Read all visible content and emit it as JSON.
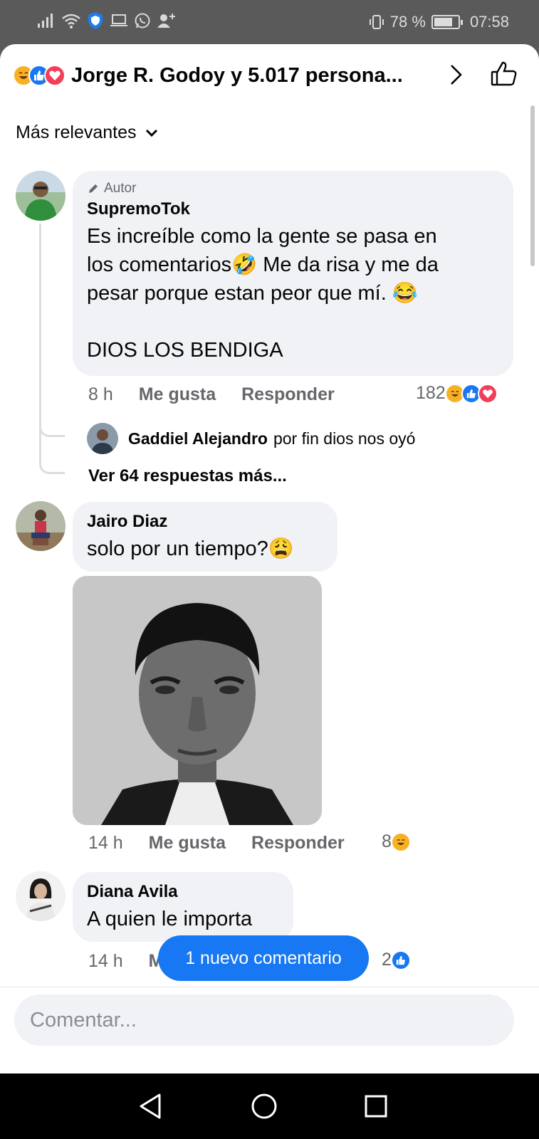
{
  "status_bar": {
    "battery_text": "78 %",
    "battery_level": 0.78,
    "time": "07:58"
  },
  "header": {
    "title": "Jorge R. Godoy y 5.017 persona...",
    "reaction_icons": [
      "haha-icon",
      "like-icon",
      "love-icon"
    ]
  },
  "sort": {
    "label": "Más relevantes"
  },
  "comments": [
    {
      "author_tag": "Autor",
      "name": "SupremoTok",
      "text_lines": [
        "Es increíble como la gente se pasa en",
        "los comentarios🤣 Me da risa y me da",
        "pesar porque estan peor que mí. 😂",
        "",
        "DIOS LOS BENDIGA"
      ],
      "time": "8 h",
      "like": "Me gusta",
      "reply": "Responder",
      "reaction_count": "182",
      "reply_preview": {
        "name": "Gaddiel Alejandro",
        "text": "por fin dios nos oyó"
      },
      "more_replies": "Ver 64 respuestas más..."
    },
    {
      "name": "Jairo Diaz",
      "text": "solo por un tiempo?😩",
      "time": "14 h",
      "like": "Me gusta",
      "reply": "Responder",
      "reaction_count": "8"
    },
    {
      "name": "Diana Avila",
      "text": "A quien le importa",
      "time": "14 h",
      "like": "M",
      "reaction_count": "2"
    }
  ],
  "toast": {
    "label": "1 nuevo comentario"
  },
  "composer": {
    "placeholder": "Comentar..."
  },
  "colors": {
    "accent": "#1877f2",
    "haha": "#f7b125",
    "love": "#f33e58",
    "bubble": "#f0f2f5",
    "secondary_text": "#65676b"
  }
}
